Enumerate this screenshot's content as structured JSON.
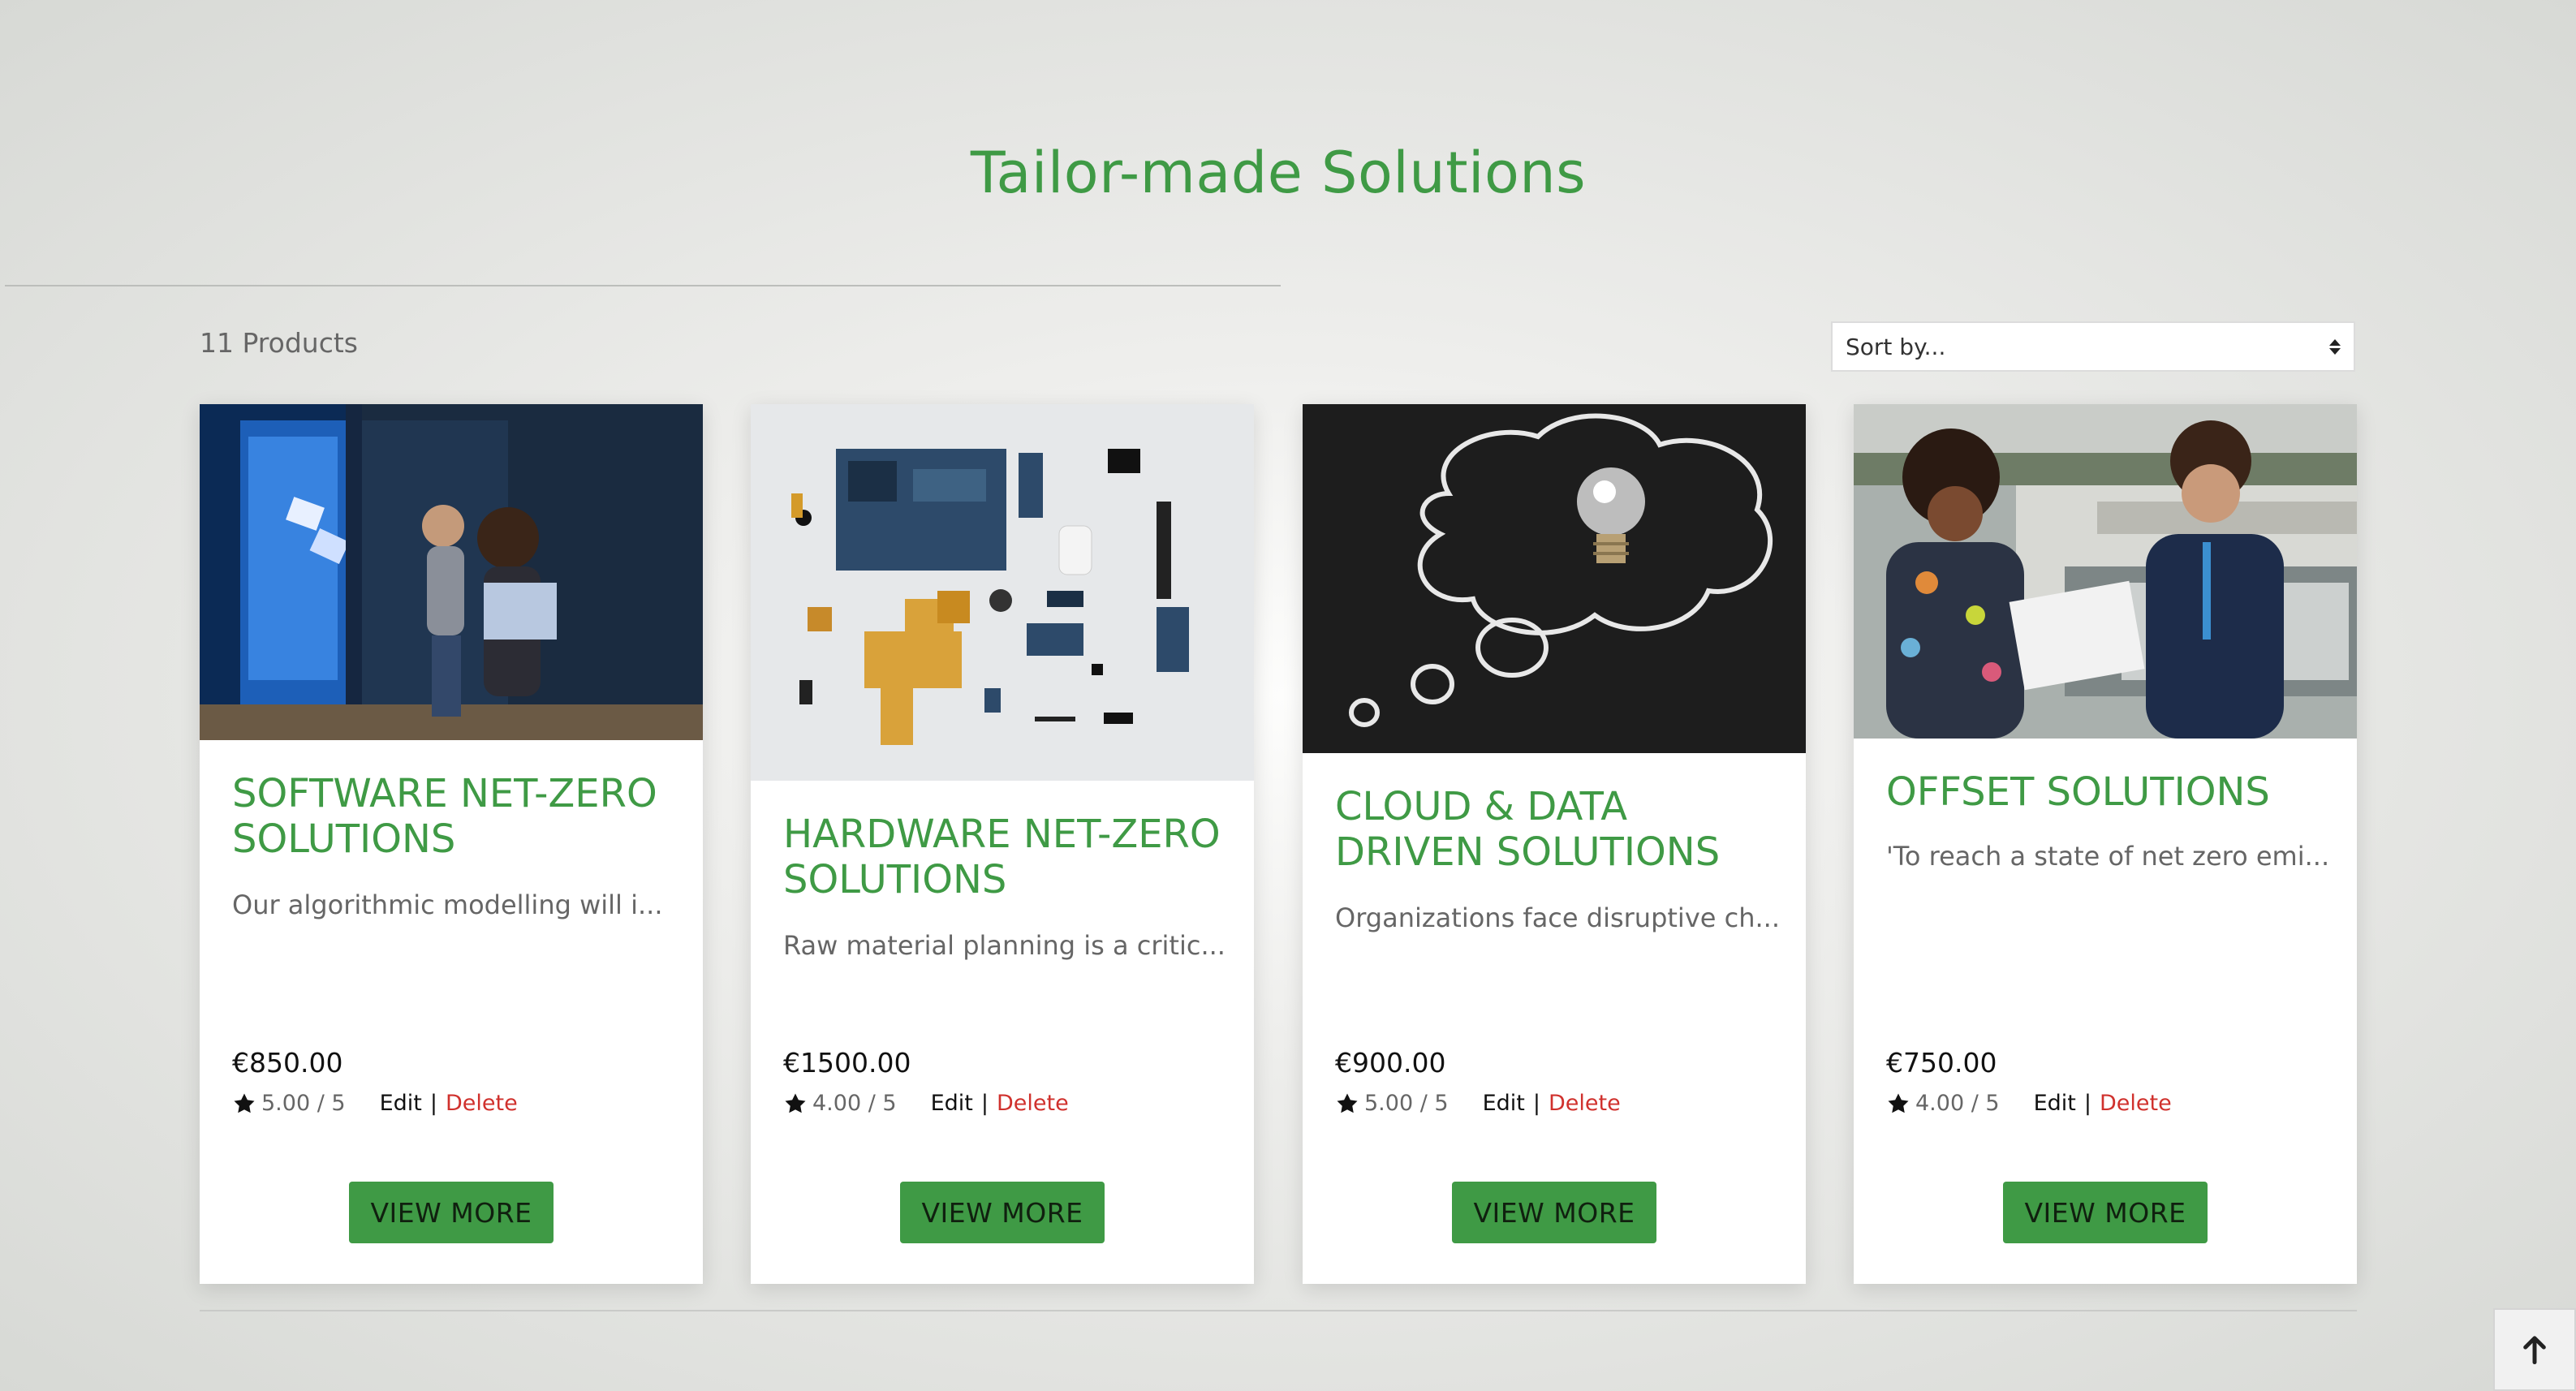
{
  "page": {
    "title": "Tailor-made Solutions",
    "product_count": "11 Products",
    "sort_placeholder": "Sort by...",
    "accent_color": "#3f9a45",
    "danger_color": "#d0312d"
  },
  "products": [
    {
      "title": "SOFTWARE NET-ZERO SOLUTIONS",
      "description": "Our algorithmic modelling will i...",
      "price": "€850.00",
      "rating": "5.00 / 5",
      "edit_label": "Edit",
      "separator": "|",
      "delete_label": "Delete",
      "button_label": "VIEW MORE",
      "image": "person-with-laptop-in-digital-gallery"
    },
    {
      "title": "HARDWARE NET-ZERO SOLUTIONS",
      "description": "Raw material planning is a critic...",
      "price": "€1500.00",
      "rating": "4.00 / 5",
      "edit_label": "Edit",
      "separator": "|",
      "delete_label": "Delete",
      "button_label": "VIEW MORE",
      "image": "disassembled-phone-components"
    },
    {
      "title": "CLOUD & DATA DRIVEN SOLUTIONS",
      "description": "Organizations face disruptive ch...",
      "price": "€900.00",
      "rating": "5.00 / 5",
      "edit_label": "Edit",
      "separator": "|",
      "delete_label": "Delete",
      "button_label": "VIEW MORE",
      "image": "light-bulb-on-chalkboard-thought-cloud"
    },
    {
      "title": "OFFSET SOLUTIONS",
      "description": "'To reach a state of net zero emi...",
      "price": "€750.00",
      "rating": "4.00 / 5",
      "edit_label": "Edit",
      "separator": "|",
      "delete_label": "Delete",
      "button_label": "VIEW MORE",
      "image": "two-people-discussing-plans-at-weir"
    }
  ],
  "scroll_top_icon": "arrow-up-icon"
}
